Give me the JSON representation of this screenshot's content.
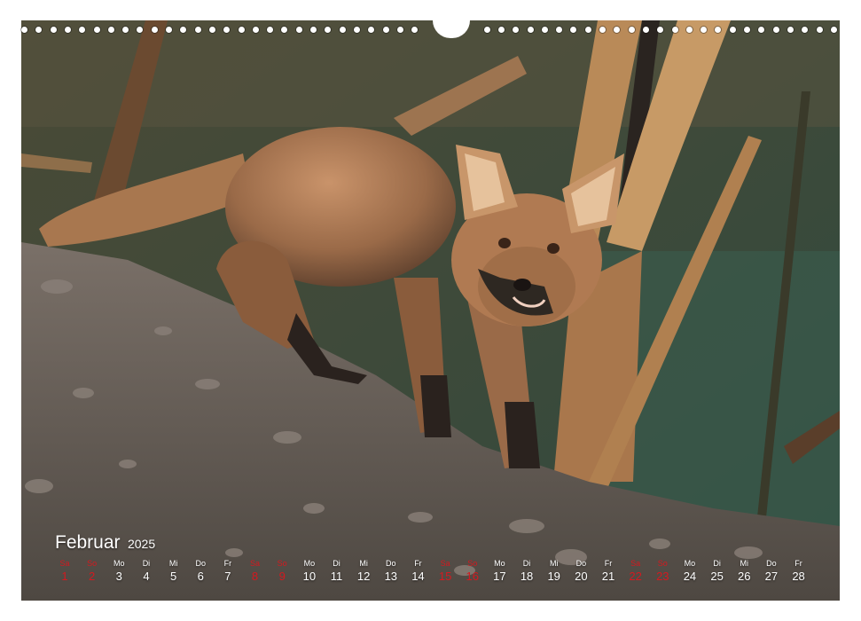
{
  "calendar": {
    "month": "Februar",
    "year": "2025",
    "days": [
      {
        "wd": "Sa",
        "num": "1",
        "we": true
      },
      {
        "wd": "So",
        "num": "2",
        "we": true
      },
      {
        "wd": "Mo",
        "num": "3",
        "we": false
      },
      {
        "wd": "Di",
        "num": "4",
        "we": false
      },
      {
        "wd": "Mi",
        "num": "5",
        "we": false
      },
      {
        "wd": "Do",
        "num": "6",
        "we": false
      },
      {
        "wd": "Fr",
        "num": "7",
        "we": false
      },
      {
        "wd": "Sa",
        "num": "8",
        "we": true
      },
      {
        "wd": "So",
        "num": "9",
        "we": true
      },
      {
        "wd": "Mo",
        "num": "10",
        "we": false
      },
      {
        "wd": "Di",
        "num": "11",
        "we": false
      },
      {
        "wd": "Mi",
        "num": "12",
        "we": false
      },
      {
        "wd": "Do",
        "num": "13",
        "we": false
      },
      {
        "wd": "Fr",
        "num": "14",
        "we": false
      },
      {
        "wd": "Sa",
        "num": "15",
        "we": true
      },
      {
        "wd": "So",
        "num": "16",
        "we": true
      },
      {
        "wd": "Mo",
        "num": "17",
        "we": false
      },
      {
        "wd": "Di",
        "num": "18",
        "we": false
      },
      {
        "wd": "Mi",
        "num": "19",
        "we": false
      },
      {
        "wd": "Do",
        "num": "20",
        "we": false
      },
      {
        "wd": "Fr",
        "num": "21",
        "we": false
      },
      {
        "wd": "Sa",
        "num": "22",
        "we": true
      },
      {
        "wd": "So",
        "num": "23",
        "we": true
      },
      {
        "wd": "Mo",
        "num": "24",
        "we": false
      },
      {
        "wd": "Di",
        "num": "25",
        "we": false
      },
      {
        "wd": "Mi",
        "num": "26",
        "we": false
      },
      {
        "wd": "Do",
        "num": "27",
        "we": false
      },
      {
        "wd": "Fr",
        "num": "28",
        "we": false
      }
    ]
  },
  "colors": {
    "weekend": "#d4191f",
    "text": "#ffffff"
  }
}
